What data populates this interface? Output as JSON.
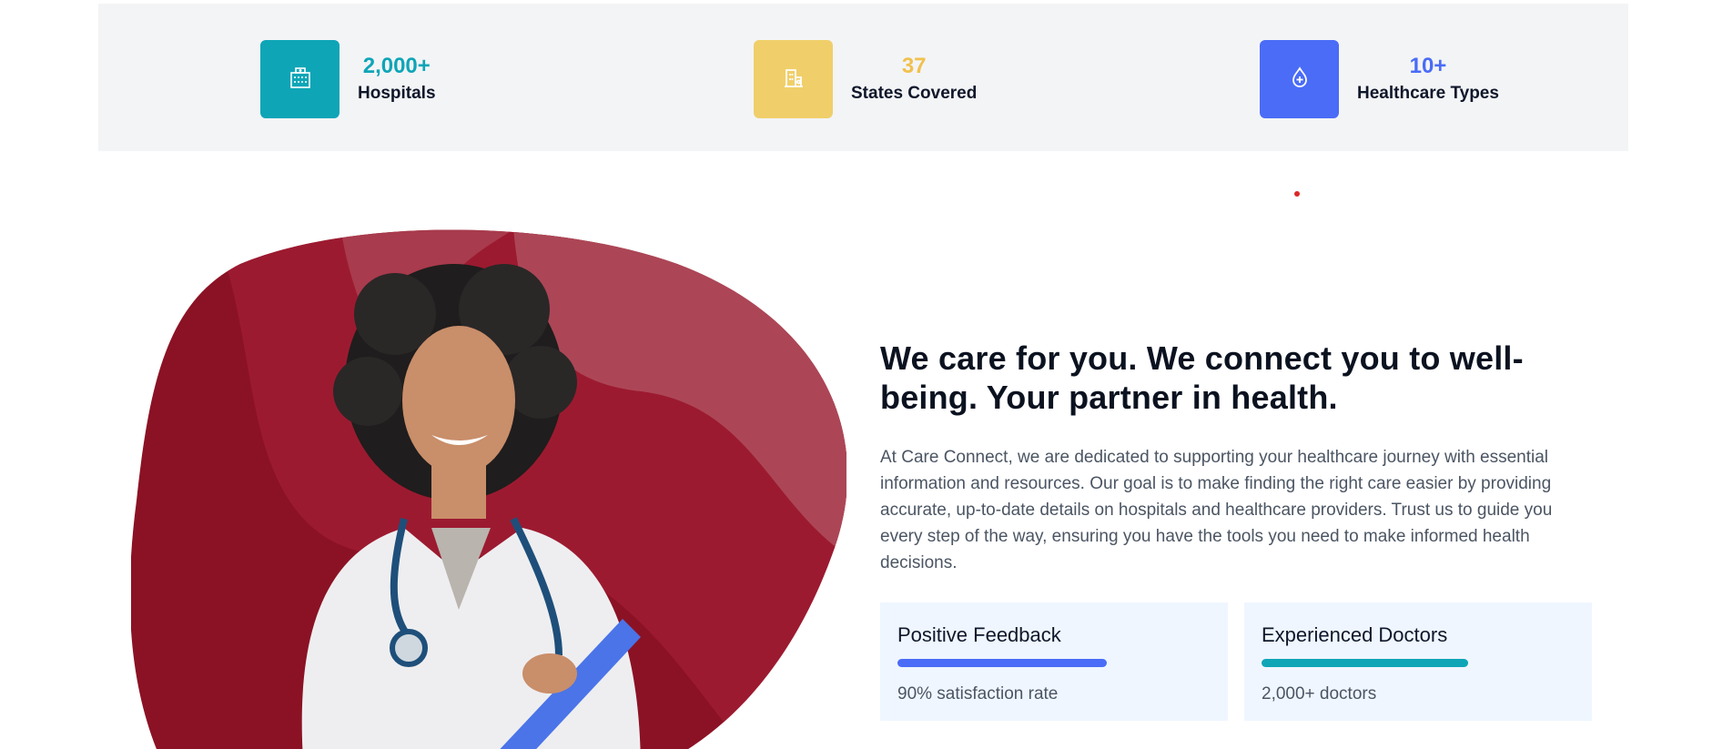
{
  "stats": [
    {
      "value": "2,000+",
      "label": "Hospitals",
      "icon": "hospital-building-icon",
      "color": "#0ea5b7"
    },
    {
      "value": "37",
      "label": "States Covered",
      "icon": "city-building-icon",
      "color": "#f0cf6a"
    },
    {
      "value": "10+",
      "label": "Healthcare Types",
      "icon": "medical-drop-icon",
      "color": "#4a6cf7"
    }
  ],
  "about": {
    "title": "We care for you. We connect you to well-being. Your partner in health.",
    "body": "At Care Connect, we are dedicated to supporting your healthcare journey with essential information and resources. Our goal is to make finding the right care easier by providing accurate, up-to-date details on hospitals and healthcare providers. Trust us to guide you every step of the way, ensuring you have the tools you need to make informed health decisions."
  },
  "cards": [
    {
      "title": "Positive Feedback",
      "subtitle": "90% satisfaction rate",
      "progress": 0.67,
      "color": "#4a6cf7"
    },
    {
      "title": "Experienced Doctors",
      "subtitle": "2,000+ doctors",
      "progress": 0.66,
      "color": "#0ea5b7"
    }
  ],
  "colors": {
    "band": "#f3f4f6",
    "hero_red": "#8b1224",
    "card_bg": "#eff6ff"
  }
}
